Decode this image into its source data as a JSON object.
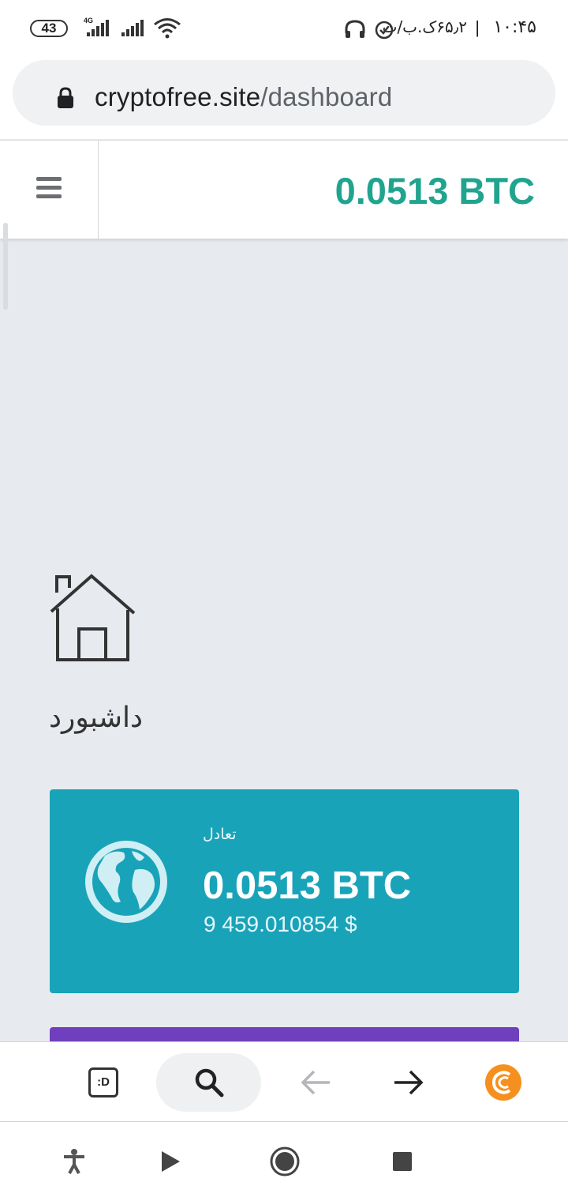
{
  "status_bar": {
    "battery": "43",
    "network": "4G",
    "clock": "۱۰:۴۵",
    "separator": "|",
    "carrier_info": "۶۵٫۲ک.ب/ث"
  },
  "url_bar": {
    "domain": "cryptofree.site",
    "path": "/dashboard"
  },
  "header": {
    "balance": "0.0513 BTC"
  },
  "dashboard": {
    "title": "داشبورد",
    "balance_card": {
      "label": "تعادل",
      "btc": "0.0513 BTC",
      "usd": "9 459.010854 $"
    }
  },
  "toolbar": {
    "tabs_label": ":D"
  },
  "colors": {
    "accent": "#21a48f",
    "card": "#19a3b9",
    "purple": "#6f3fbd",
    "extension": "#f5901e"
  },
  "icons": [
    "lock-icon",
    "hamburger-menu-icon",
    "home-icon",
    "globe-icon",
    "search-icon",
    "back-arrow-icon",
    "forward-arrow-icon",
    "coin-extension-icon",
    "accessibility-icon",
    "play-icon",
    "record-icon",
    "stop-icon"
  ]
}
